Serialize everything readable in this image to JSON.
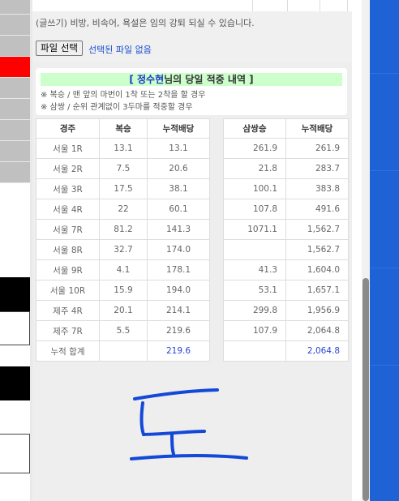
{
  "notice": "(글쓰기) 비방, 비속어, 욕설은 임의 강퇴 되실 수 있습니다.",
  "file_button": "파일 선택",
  "file_status": "선택된 파일 없음",
  "summary": {
    "title_open": "[ ",
    "user_name": "정수현",
    "title_rest": "님의 당일 적중 내역 ]",
    "note1": "※ 복승 / 맨 앞의 마번이 1착 또는 2착을 할 경우",
    "note2": "※ 삼쌍 / 순위 관계없이 3두마를 적중할 경우"
  },
  "left_table": {
    "headers": [
      "경주",
      "복승",
      "누적배당"
    ],
    "rows": [
      [
        "서울 1R",
        "13.1",
        "13.1"
      ],
      [
        "서울 2R",
        "7.5",
        "20.6"
      ],
      [
        "서울 3R",
        "17.5",
        "38.1"
      ],
      [
        "서울 4R",
        "22",
        "60.1"
      ],
      [
        "서울 7R",
        "81.2",
        "141.3"
      ],
      [
        "서울 8R",
        "32.7",
        "174.0"
      ],
      [
        "서울 9R",
        "4.1",
        "178.1"
      ],
      [
        "서울 10R",
        "15.9",
        "194.0"
      ],
      [
        "제주 4R",
        "20.1",
        "214.1"
      ],
      [
        "제주 7R",
        "5.5",
        "219.6"
      ]
    ],
    "total_label": "누적 합계",
    "total_value": "219.6"
  },
  "right_table": {
    "headers": [
      "삼쌍승",
      "누적배당"
    ],
    "rows": [
      [
        "261.9",
        "261.9"
      ],
      [
        "21.8",
        "283.7"
      ],
      [
        "100.1",
        "383.8"
      ],
      [
        "107.8",
        "491.6"
      ],
      [
        "1071.1",
        "1,562.7"
      ],
      [
        "",
        "1,562.7"
      ],
      [
        "41.3",
        "1,604.0"
      ],
      [
        "53.1",
        "1,657.1"
      ],
      [
        "299.8",
        "1,956.9"
      ],
      [
        "107.9",
        "2,064.8"
      ]
    ],
    "total_value": "2,064.8"
  },
  "handwriting_text": "도",
  "colors": {
    "accent_red": "#ff0000",
    "summary_bg": "#ccffcc",
    "link_blue": "#1a4fcf",
    "total_blue": "#2a44d6",
    "handwriting_blue": "#1448d8",
    "desktop_blue": "#1e62d6"
  }
}
